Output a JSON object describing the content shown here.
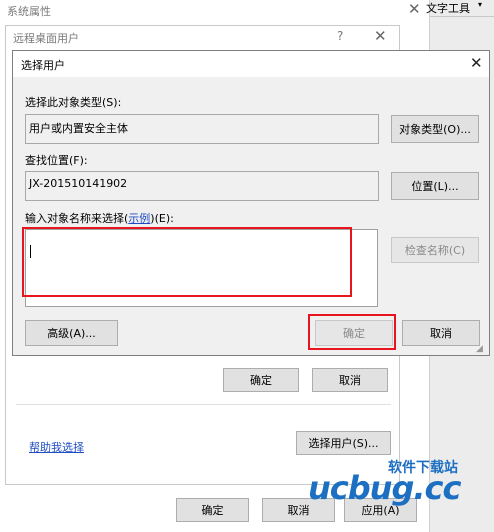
{
  "system_properties": {
    "title": "系统属性",
    "taskbar_text": "文字工具",
    "ok_label": "确定",
    "cancel_label": "取消",
    "apply_label": "应用(A)"
  },
  "remote_desktop_users": {
    "title": "远程桌面用户",
    "help_symbol": "?",
    "ok_label": "确定",
    "cancel_label": "取消",
    "help_link": "帮助我选择",
    "select_users_label": "选择用户(S)..."
  },
  "select_users": {
    "title": "选择用户",
    "object_type_label": "选择此对象类型(S):",
    "object_type_value": "用户或内置安全主体",
    "object_types_button": "对象类型(O)...",
    "location_label": "查找位置(F):",
    "location_value": "JX-201510141902",
    "locations_button": "位置(L)...",
    "enter_names_label_prefix": "输入对象名称来选择(",
    "enter_names_link": "示例",
    "enter_names_label_suffix": ")(E):",
    "enter_names_value": "",
    "check_names_button": "检查名称(C)",
    "advanced_button": "高级(A)...",
    "ok_button": "确定",
    "cancel_button": "取消"
  },
  "watermark": {
    "brand": "ucbug.cc",
    "tagline": "软件下载站"
  },
  "colors": {
    "highlight": "#e8141e",
    "link": "#1f4ec4",
    "watermark_orange": "#f28c1c",
    "watermark_blue": "#1d6fc2"
  }
}
